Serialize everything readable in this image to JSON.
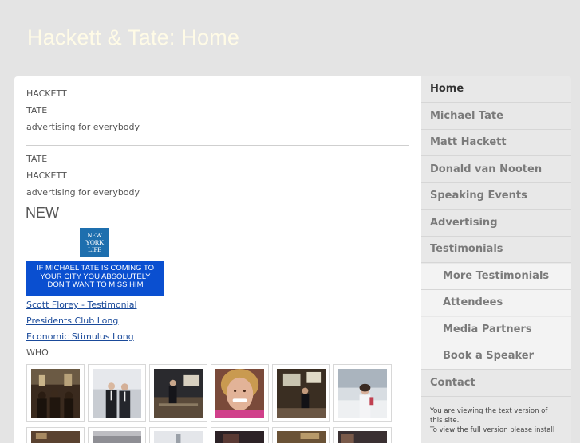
{
  "site": {
    "title": "Hackett & Tate: Home"
  },
  "content": {
    "block1": [
      "HACKETT",
      "TATE",
      "advertising for everybody"
    ],
    "block2": [
      "TATE",
      "HACKETT",
      "advertising for everybody"
    ],
    "new_heading": "NEW",
    "ny_logo": [
      "NEW",
      "YORK",
      "LIFE"
    ],
    "ny_banner": [
      "IF MICHAEL TATE IS COMING TO",
      "YOUR CITY YOU ABSOLUTELY",
      "DON'T WANT TO MISS HIM"
    ],
    "links": [
      "Scott Florey - Testimonial",
      "Presidents Club Long",
      "Economic Stimulus Long"
    ],
    "who_label": "WHO"
  },
  "gallery": {
    "row1_icons": [
      "photo-speaker-room-icon",
      "photo-two-men-suits-icon",
      "photo-presenter-stage-icon",
      "photo-smiling-woman-icon",
      "photo-presenter-screen-icon",
      "photo-woman-snow-icon"
    ],
    "row2_icons": [
      "photo-icon",
      "photo-icon",
      "photo-icon",
      "photo-icon",
      "photo-icon",
      "photo-icon"
    ]
  },
  "nav": {
    "items": [
      {
        "label": "Home",
        "level": "top",
        "active": true
      },
      {
        "label": "Michael Tate",
        "level": "top",
        "active": false
      },
      {
        "label": "Matt Hackett",
        "level": "top",
        "active": false
      },
      {
        "label": "Donald van Nooten",
        "level": "top",
        "active": false
      },
      {
        "label": "Speaking Events",
        "level": "top",
        "active": false
      },
      {
        "label": "Advertising",
        "level": "top",
        "active": false
      },
      {
        "label": "Testimonials",
        "level": "top",
        "active": false
      },
      {
        "label": "More Testimonials",
        "level": "sub",
        "active": false
      },
      {
        "label": "Attendees",
        "level": "sub",
        "active": false
      },
      {
        "label": "Media Partners",
        "level": "sub",
        "active": false
      },
      {
        "label": "Book a Speaker",
        "level": "sub",
        "active": false
      },
      {
        "label": "Contact",
        "level": "top",
        "active": false
      }
    ],
    "note": [
      "You are viewing the text version of",
      "this site.",
      "To view the full version please install"
    ]
  },
  "colors": {
    "background": "#e4e4e4",
    "title": "#fffbe6",
    "link": "#1a4a9a",
    "banner": "#0a4fd0",
    "ny_logo": "#1e6fae"
  }
}
